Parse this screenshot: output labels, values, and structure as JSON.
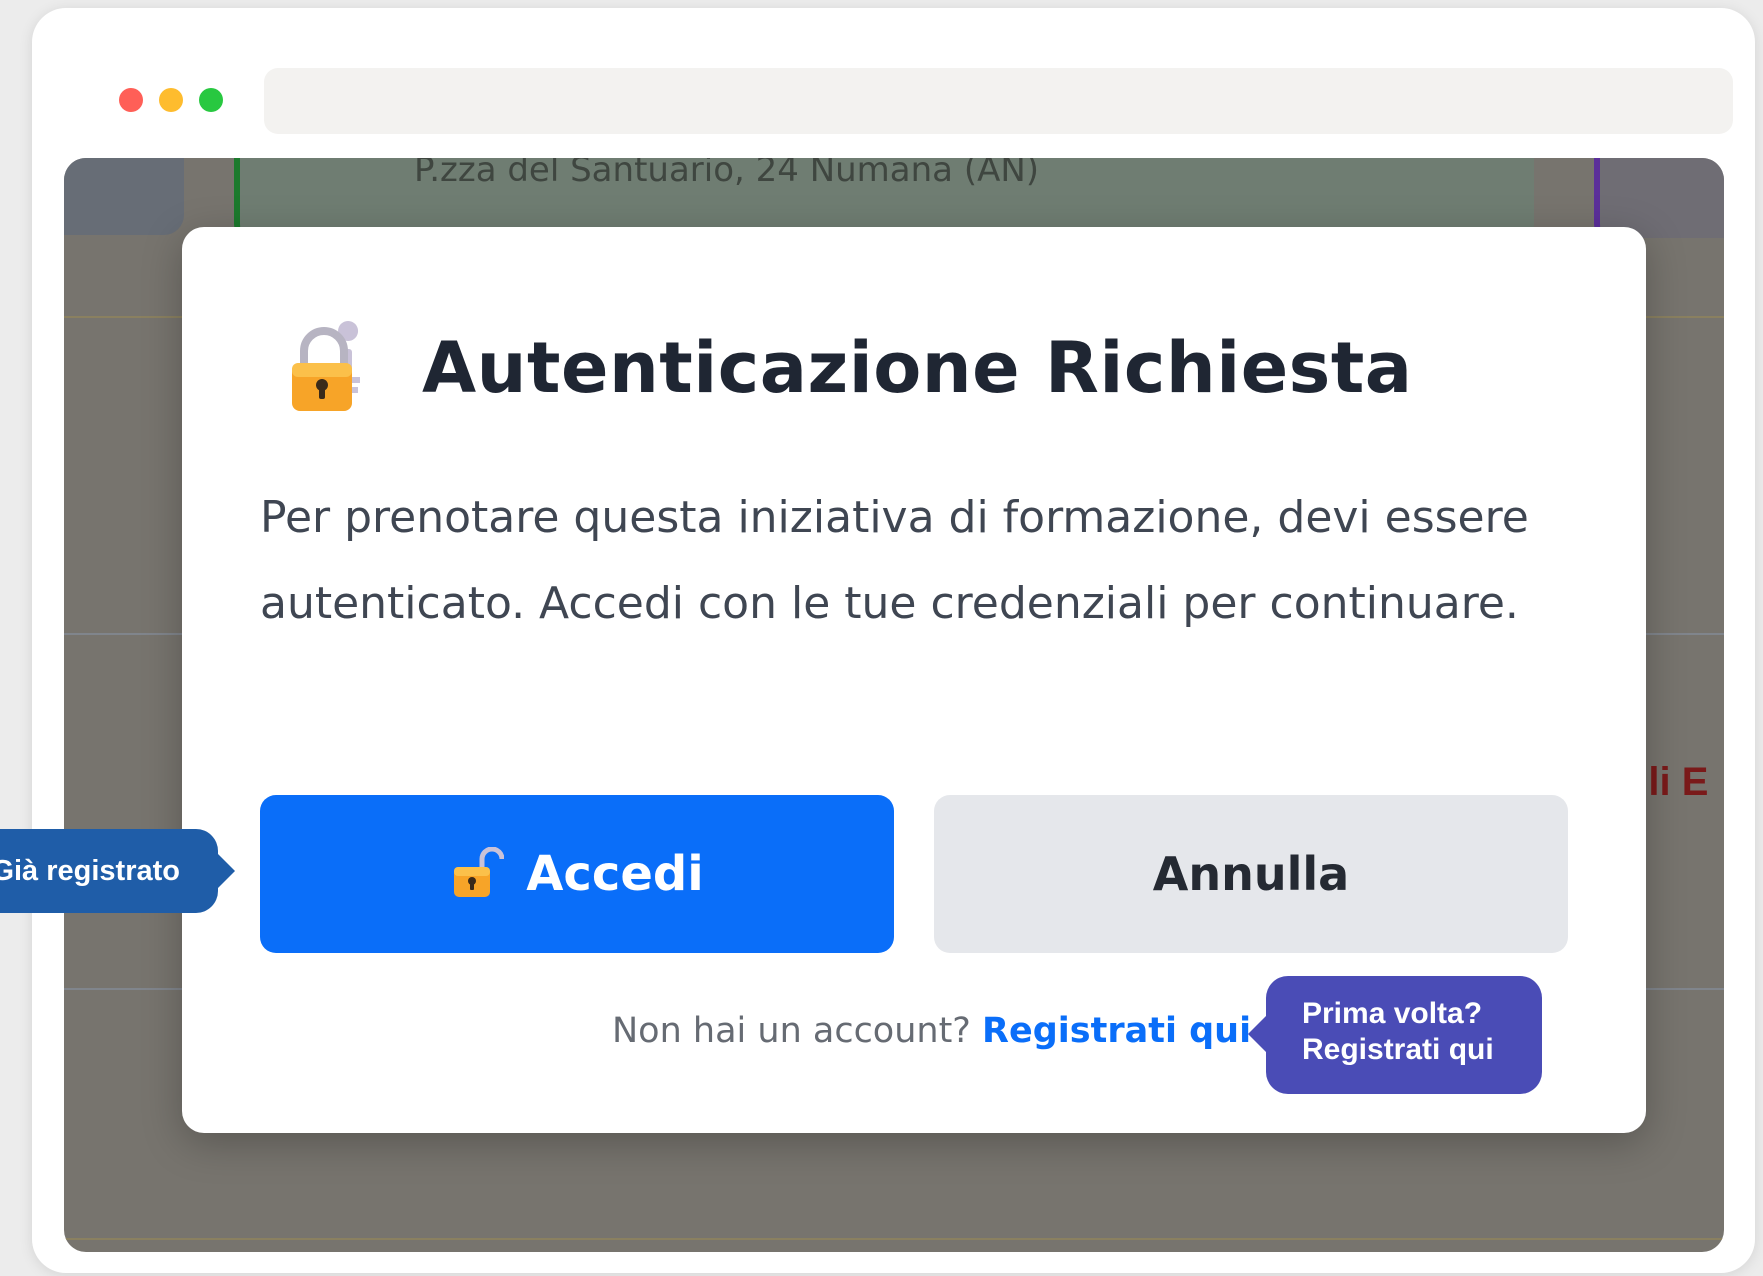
{
  "background": {
    "address": "P.zza del Santuario, 24 Numana (AN)",
    "partial_heading": "gli E"
  },
  "modal": {
    "title": "Autenticazione Richiesta",
    "title_icon": "locked-with-key-icon",
    "body": "Per prenotare questa iniziativa di formazione, devi essere autenticato. Accedi con le tue credenziali per continuare.",
    "login_button": {
      "label": "Accedi",
      "icon": "unlocked-icon"
    },
    "cancel_button": {
      "label": "Annulla"
    },
    "register_prompt": "Non hai un account?",
    "register_link": "Registrati qui"
  },
  "tooltips": {
    "left": "Già registrato",
    "right_line1": "Prima volta?",
    "right_line2": "Registrati qui"
  },
  "colors": {
    "primary": "#0a6ef9",
    "tooltip_left": "#1f5da8",
    "tooltip_right": "#4a4cb6"
  }
}
